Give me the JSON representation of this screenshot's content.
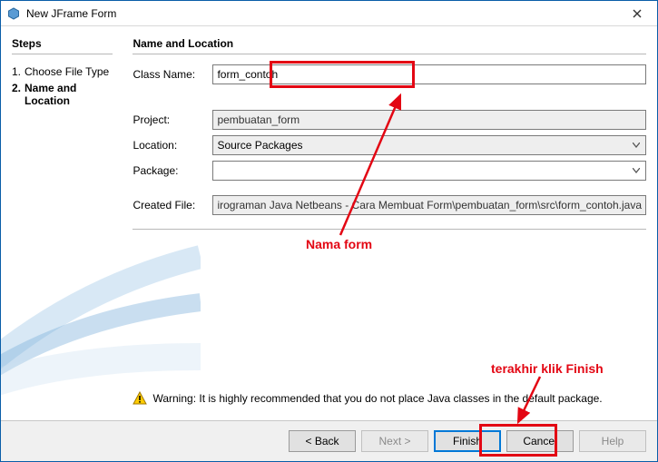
{
  "window": {
    "title": "New JFrame Form"
  },
  "sidebar": {
    "heading": "Steps",
    "steps": [
      {
        "num": "1.",
        "label": "Choose File Type"
      },
      {
        "num": "2.",
        "label": "Name and Location"
      }
    ]
  },
  "main": {
    "heading": "Name and Location",
    "class_name_label": "Class Name:",
    "class_name_value": "form_contoh",
    "project_label": "Project:",
    "project_value": "pembuatan_form",
    "location_label": "Location:",
    "location_value": "Source Packages",
    "package_label": "Package:",
    "package_value": "",
    "created_file_label": "Created File:",
    "created_file_value": "irograman Java Netbeans - Cara Membuat Form\\pembuatan_form\\src\\form_contoh.java",
    "warning_text": "Warning: It is highly recommended that you do not place Java classes in the default package."
  },
  "buttons": {
    "back": "< Back",
    "next": "Next >",
    "finish": "Finish",
    "cancel": "Cancel",
    "help": "Help"
  },
  "annotations": {
    "label1": "Nama form",
    "label2": "terakhir klik Finish"
  }
}
